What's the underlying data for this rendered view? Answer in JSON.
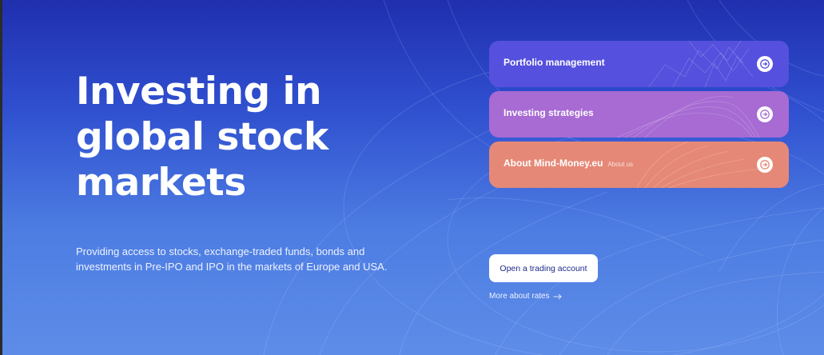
{
  "hero": {
    "title": "Investing in global stock markets",
    "subtitle": "Providing access to stocks, exchange-traded funds, bonds and investments in Pre-IPO and IPO in the markets of Europe and USA."
  },
  "cards": [
    {
      "label": "Portfolio management",
      "sublabel": "",
      "color": "#5550dd",
      "icon": "arrow-right-icon"
    },
    {
      "label": "Investing strategies",
      "sublabel": "",
      "color": "#a76bd3",
      "icon": "arrow-right-icon"
    },
    {
      "label": "About Mind-Money.eu",
      "sublabel": "About us",
      "color": "#e68877",
      "icon": "arrow-right-icon"
    }
  ],
  "cta": {
    "button_label": "Open a trading account",
    "link_label": "More about rates",
    "link_icon": "arrow-right-icon"
  },
  "colors": {
    "background_top": "#1f2fae",
    "background_bottom": "#5d8ce8",
    "button_text": "#1e2a8a"
  }
}
